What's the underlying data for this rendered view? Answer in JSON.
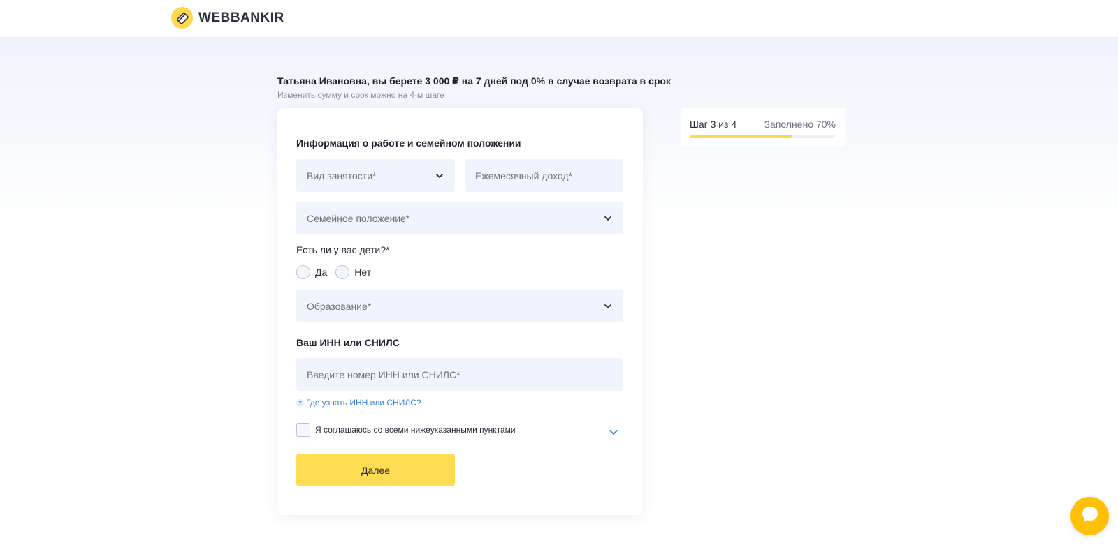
{
  "header": {
    "logo_text": "WEBBANKIR"
  },
  "offer": {
    "headline": "Татьяна Ивановна, вы берете 3 000 ₽ на 7 дней под 0% в случае возврата в срок",
    "subline": "Изменить сумму и срок можно на 4-м шаге"
  },
  "form": {
    "section_work_title": "Информация о работе и семейном положении",
    "employment_placeholder": "Вид занятости*",
    "income_placeholder": "Ежемесячный доход*",
    "marital_placeholder": "Семейное положение*",
    "children_question": "Есть ли у вас дети?*",
    "children_yes": "Да",
    "children_no": "Нет",
    "education_placeholder": "Образование*",
    "section_inn_title": "Ваш ИНН или СНИЛС",
    "inn_placeholder": "Введите номер ИНН или СНИЛС*",
    "inn_help_icon": "?",
    "inn_help_link": "Где узнать ИНН или СНИЛС?",
    "agree_text": "Я соглашаюсь со всеми нижеуказанными пунктами",
    "next_label": "Далее"
  },
  "progress": {
    "step_text": "Шаг 3 из 4",
    "filled_text": "Заполнено 70%",
    "filled_fraction": 0.7
  },
  "colors": {
    "accent_yellow": "#ffd84d",
    "button_yellow": "#ffdc52",
    "chat_orange": "#ffc107",
    "field_bg": "#f0f4fd",
    "link_blue": "#3b82d8"
  },
  "icons": {
    "logo": "webbankir-logo-icon",
    "dropdown": "chevron-down-icon",
    "help": "question-icon",
    "chat": "chat-bubble-icon"
  }
}
